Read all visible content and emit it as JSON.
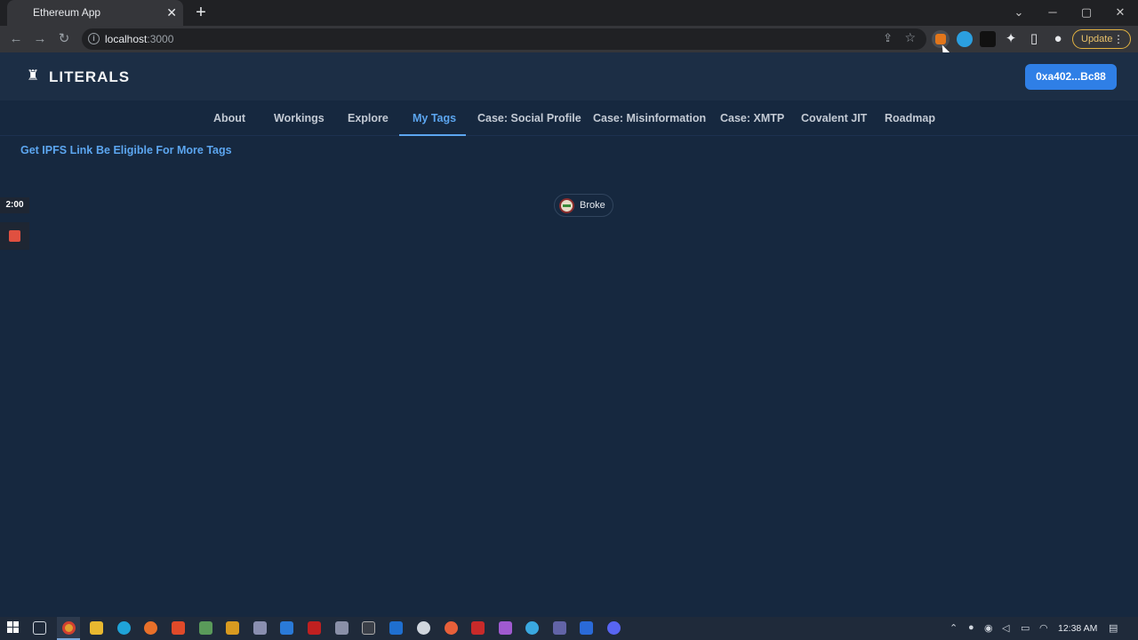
{
  "browser": {
    "tab_title": "Ethereum App",
    "tab_close": "✕",
    "new_tab": "+",
    "url_host": "localhost",
    "url_port": ":3000",
    "update_label": "Update",
    "window_controls": [
      "⌄",
      "─",
      "▢",
      "✕"
    ]
  },
  "app": {
    "logo_text": "LITERALS",
    "wallet_button": "0xa402...Bc88",
    "nav": [
      {
        "label": "About"
      },
      {
        "label": "Workings"
      },
      {
        "label": "Explore"
      },
      {
        "label": "My Tags",
        "active": true
      },
      {
        "label": "Case: Social Profile"
      },
      {
        "label": "Case: Misinformation"
      },
      {
        "label": "Case: XMTP"
      },
      {
        "label": "Covalent JIT"
      },
      {
        "label": "Roadmap"
      }
    ],
    "sublinks": [
      "Get IPFS Link",
      "Be Eligible For More Tags"
    ],
    "tags": [
      {
        "label": "Broke"
      }
    ]
  },
  "recorder": {
    "time": "2:00"
  },
  "taskbar": {
    "clock": "12:38 AM"
  },
  "colors": {
    "page_bg": "#16283f",
    "header_bg": "#1c2e45",
    "accent": "#5ca6f0",
    "wallet_button": "#2f7fe6"
  }
}
